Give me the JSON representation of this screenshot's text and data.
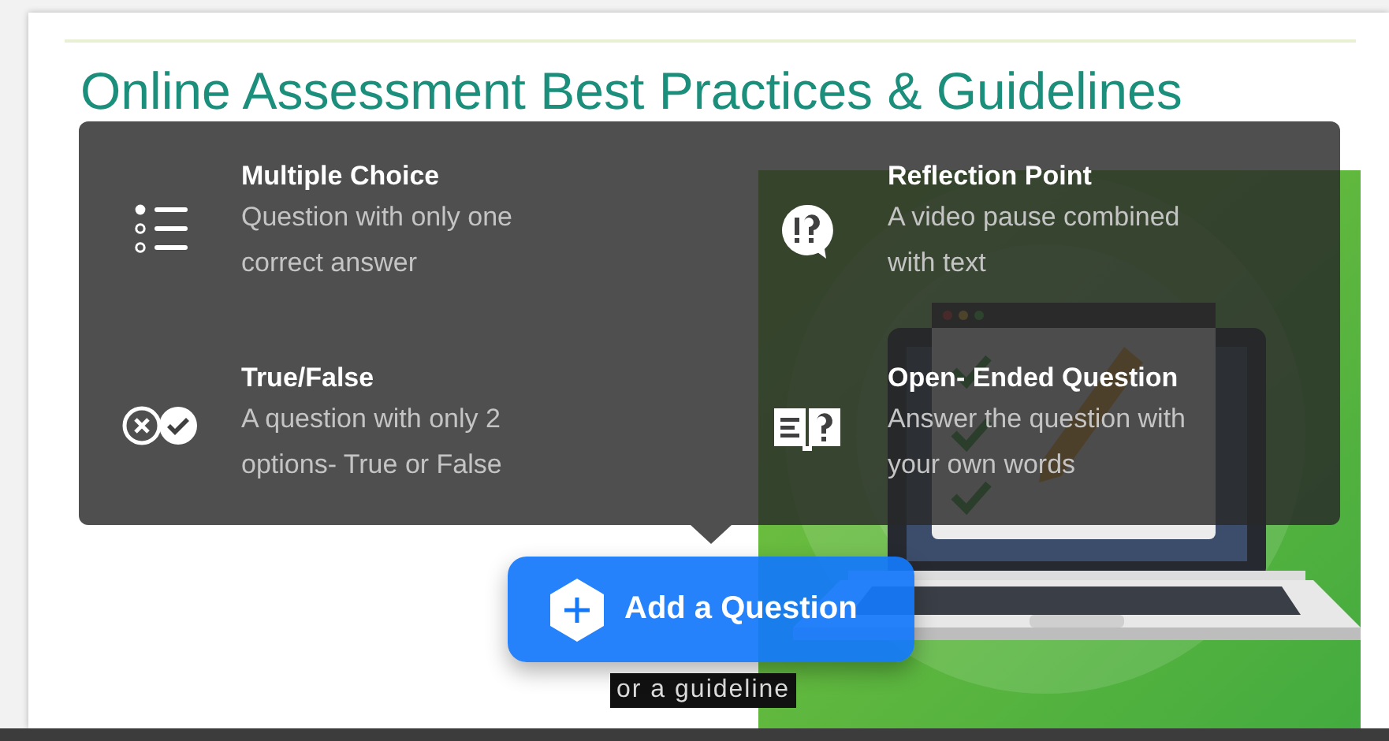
{
  "slide": {
    "title": "Online Assessment Best Practices & Guidelines",
    "caption": "or a guideline"
  },
  "question_menu": {
    "items": [
      {
        "kind": "list",
        "title": "Multiple Choice",
        "description": "Question with only one correct answer"
      },
      {
        "kind": "reflection",
        "title": "Reflection Point",
        "description": "A video pause combined with text"
      },
      {
        "kind": "truefalse",
        "title": "True/False",
        "description": "A question with only 2 options- True or False"
      },
      {
        "kind": "openended",
        "title": "Open- Ended Question",
        "description": "Answer the question with your own words"
      }
    ]
  },
  "add_button": {
    "label": "Add a Question"
  }
}
